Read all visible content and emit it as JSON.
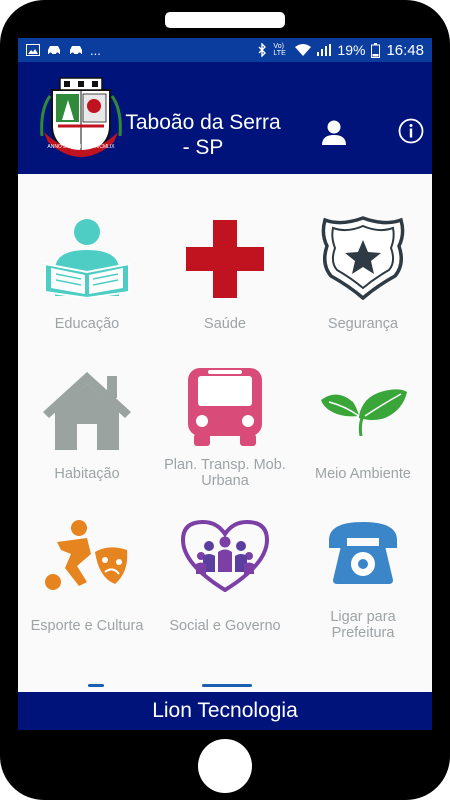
{
  "status_bar": {
    "battery_percent": "19%",
    "time": "16:48",
    "network": "Vo) LTE",
    "notification_more": "..."
  },
  "header": {
    "title_line1": "Taboão da Serra",
    "title_line2": "- SP",
    "crest_text": "ANNO DOMINI 1959 MCMLIX"
  },
  "tiles": [
    {
      "label": "Educação",
      "icon": "reading-person-icon",
      "color": "#4ecdc4"
    },
    {
      "label": "Saúde",
      "icon": "red-cross-icon",
      "color": "#c1121f"
    },
    {
      "label": "Segurança",
      "icon": "police-badge-icon",
      "color": "#2f3b44"
    },
    {
      "label": "Habitação",
      "icon": "house-icon",
      "color": "#9aa39f"
    },
    {
      "label_line1": "Plan. Transp. Mob.",
      "label_line2": "Urbana",
      "icon": "bus-icon",
      "color": "#d94b78"
    },
    {
      "label": "Meio Ambiente",
      "icon": "leaves-icon",
      "color": "#3aa63a"
    },
    {
      "label": "Esporte e Cultura",
      "icon": "sport-culture-icon",
      "color": "#e6851f"
    },
    {
      "label": "Social e Governo",
      "icon": "family-heart-icon",
      "color": "#7b3fa6"
    },
    {
      "label_line1": "Ligar para",
      "label_line2": "Prefeitura",
      "icon": "telephone-icon",
      "color": "#3b86c9"
    }
  ],
  "footer": {
    "text": "Lion Tecnologia"
  },
  "colors": {
    "status_bar": "#0a3d9e",
    "header": "#00137a",
    "label": "#9ea3a6"
  }
}
